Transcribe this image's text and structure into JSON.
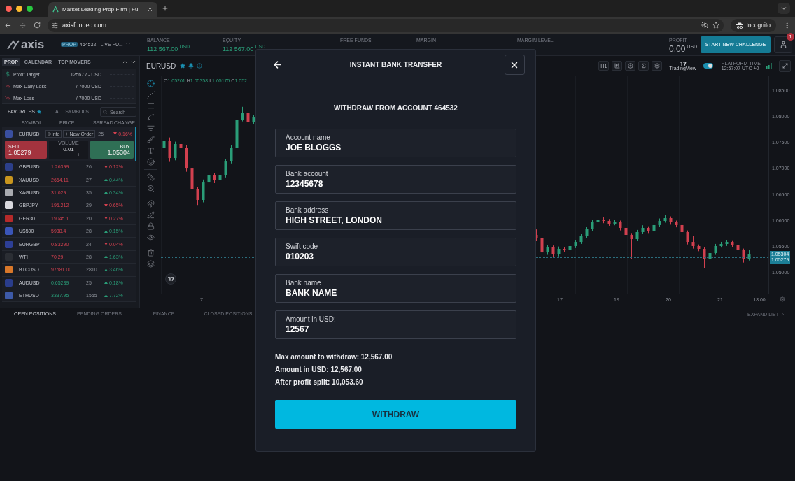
{
  "browser": {
    "tab_title": "Market Leading Prop Firm | Fu",
    "url": "axisfunded.com",
    "incognito_label": "Incognito"
  },
  "header": {
    "logo": "axis",
    "account": {
      "badge": "PROP",
      "name": "464532 - LIVE FU..."
    },
    "stats": [
      {
        "label": "BALANCE",
        "value": "112 567.00",
        "unit": "USD"
      },
      {
        "label": "EQUITY",
        "value": "112 567.00",
        "unit": "USD"
      },
      {
        "label": "FREE FUNDS"
      },
      {
        "label": "MARGIN"
      },
      {
        "label": "MARGIN LEVEL"
      }
    ],
    "profit": {
      "label": "PROFIT",
      "value": "0.00",
      "unit": "USD"
    },
    "challenge_button": "START NEW CHALLENGE",
    "notifications": "1"
  },
  "left_panel": {
    "tabs": [
      {
        "label": "PROP",
        "selected": true
      },
      {
        "label": "CALENDAR",
        "selected": false
      },
      {
        "label": "TOP MOVERS",
        "selected": false
      }
    ],
    "targets": [
      {
        "kind": "profit",
        "label": "Profit Target",
        "value": "12567 / - USD"
      },
      {
        "kind": "loss",
        "label": "Max Daily Loss",
        "value": "- / 7000 USD"
      },
      {
        "kind": "loss",
        "label": "Max Loss",
        "value": "- / 7000 USD"
      }
    ],
    "symbol_tabs": [
      {
        "label": "FAVORITES",
        "selected": true,
        "starred": true
      },
      {
        "label": "ALL SYMBOLS",
        "selected": false,
        "starred": false
      }
    ],
    "search": {
      "placeholder": "Search"
    },
    "columns": [
      "SYMBOL",
      "PRICE",
      "SPREAD",
      "CHANGE"
    ],
    "active_symbol": {
      "symbol": "EURUSD",
      "color": "#3a4fa0",
      "info_button": "Info",
      "order_button": "New Order",
      "spread": "25",
      "change": "0.16%",
      "change_up": false,
      "sell": {
        "label": "SELL",
        "price": "1.05279"
      },
      "volume": {
        "label": "VOLUME",
        "value": "0.01",
        "minus": "−",
        "plus": "+"
      },
      "buy": {
        "label": "BUY",
        "price": "1.05304"
      }
    },
    "symbols": [
      {
        "symbol": "GBPUSD",
        "color": "#2c3f8a",
        "price": "1.26399",
        "price_up": false,
        "spread": "26",
        "change": "0.12%",
        "change_up": false
      },
      {
        "symbol": "XAUUSD",
        "color": "#c9961e",
        "price": "2664.11",
        "price_up": false,
        "spread": "27",
        "change": "0.44%",
        "change_up": true
      },
      {
        "symbol": "XAGUSD",
        "color": "#a9abb0",
        "price": "31.029",
        "price_up": false,
        "spread": "35",
        "change": "0.34%",
        "change_up": true
      },
      {
        "symbol": "GBPJPY",
        "color": "#d9d9de",
        "price": "195.212",
        "price_up": false,
        "spread": "29",
        "change": "0.65%",
        "change_up": false
      },
      {
        "symbol": "GER30",
        "color": "#b52a2a",
        "price": "19045.1",
        "price_up": false,
        "spread": "20",
        "change": "0.27%",
        "change_up": false
      },
      {
        "symbol": "US500",
        "color": "#3a55b8",
        "price": "5938.4",
        "price_up": false,
        "spread": "28",
        "change": "0.15%",
        "change_up": true
      },
      {
        "symbol": "EURGBP",
        "color": "#2d3f96",
        "price": "0.83290",
        "price_up": false,
        "spread": "24",
        "change": "0.04%",
        "change_up": false
      },
      {
        "symbol": "WTI",
        "color": "#2b2e34",
        "price": "70.29",
        "price_up": false,
        "spread": "28",
        "change": "1.63%",
        "change_up": true
      },
      {
        "symbol": "BTCUSD",
        "color": "#d9782a",
        "price": "97581.00",
        "price_up": false,
        "spread": "2810",
        "change": "3.46%",
        "change_up": true
      },
      {
        "symbol": "AUDUSD",
        "color": "#2a3d8c",
        "price": "0.65239",
        "price_up": true,
        "spread": "25",
        "change": "0.18%",
        "change_up": true
      },
      {
        "symbol": "ETHUSD",
        "color": "#3d5aa8",
        "price": "3337.95",
        "price_up": true,
        "spread": "1555",
        "change": "7.72%",
        "change_up": true
      }
    ]
  },
  "chart": {
    "symbol": "EURUSD",
    "ohlc": [
      {
        "label": "O",
        "value": "1.05201"
      },
      {
        "label": "H",
        "value": "1.05358"
      },
      {
        "label": "L",
        "value": "1.05175"
      },
      {
        "label": "C",
        "value": "1.052"
      }
    ],
    "timeframe": "H1",
    "provider": "TradingView",
    "live_toggle": {
      "on": true
    },
    "platform_time": {
      "label": "PLATFORM TIME",
      "value": "12:57:07 UTC +0"
    },
    "ask": "1.05304",
    "bid": "1.05279",
    "time_labels": [
      "7",
      "17",
      "18:00"
    ],
    "chart_data": {
      "type": "candlestick",
      "xlim": [
        10.203,
        21.933
      ],
      "ylim": [
        1.0457,
        1.08783
      ],
      "xticks": [
        19,
        20,
        21
      ],
      "ref_lines": [
        {
          "value": 1.05279,
          "axis": "y"
        }
      ],
      "yticks": [
        {
          "value": 1.085,
          "label": "1.08500"
        },
        {
          "value": 1.08,
          "label": "1.08000"
        },
        {
          "value": 1.075,
          "label": "1.07500"
        },
        {
          "value": 1.07,
          "label": "1.07000"
        },
        {
          "value": 1.065,
          "label": "1.06500"
        },
        {
          "value": 1.06,
          "label": "1.06000"
        },
        {
          "value": 1.055,
          "label": "1.05500"
        },
        {
          "value": 1.05,
          "label": "1.05000"
        }
      ],
      "x": [
        10.257,
        10.365,
        10.473,
        10.581,
        10.689,
        10.798,
        10.906,
        11.014,
        11.122,
        11.23,
        11.338,
        11.446,
        11.554,
        11.662,
        11.77,
        11.878,
        11.987,
        17.446,
        17.554,
        17.662,
        17.77,
        17.878,
        17.987,
        18.095,
        18.203,
        18.311,
        18.419,
        18.527,
        18.635,
        18.743,
        18.851,
        18.959,
        19.068,
        19.176,
        19.284,
        19.392,
        19.5,
        19.608,
        19.716,
        19.824,
        19.932,
        20.041,
        20.149,
        20.257,
        20.365,
        20.473,
        20.581,
        20.689,
        20.797,
        20.905,
        21.013,
        21.121,
        21.23,
        21.338,
        21.446,
        21.554
      ],
      "ohlc": [
        [
          1.07396,
          1.0758,
          1.0734,
          1.07531
        ],
        [
          1.07531,
          1.0759,
          1.0712,
          1.07194
        ],
        [
          1.07194,
          1.0751,
          1.0715,
          1.07464
        ],
        [
          1.07464,
          1.0752,
          1.0733,
          1.07396
        ],
        [
          1.07396,
          1.0744,
          1.0693,
          1.06992
        ],
        [
          1.06992,
          1.0705,
          1.0652,
          1.06589
        ],
        [
          1.06589,
          1.0663,
          1.0629,
          1.06387
        ],
        [
          1.06387,
          1.0678,
          1.0634,
          1.06723
        ],
        [
          1.06723,
          1.0691,
          1.0668,
          1.06858
        ],
        [
          1.06858,
          1.069,
          1.0671,
          1.06764
        ],
        [
          1.06764,
          1.0692,
          1.0672,
          1.06858
        ],
        [
          1.06858,
          1.0718,
          1.0682,
          1.07127
        ],
        [
          1.07127,
          1.0745,
          1.0709,
          1.07396
        ],
        [
          1.07396,
          1.0799,
          1.0735,
          1.07935
        ],
        [
          1.07935,
          1.0818,
          1.079,
          1.08069
        ],
        [
          1.08069,
          1.0811,
          1.0783,
          1.07894
        ],
        [
          1.07894,
          1.0802,
          1.0785,
          1.07975
        ],
        [
          1.05714,
          1.0582,
          1.056,
          1.05647
        ],
        [
          1.05647,
          1.0569,
          1.0532,
          1.05377
        ],
        [
          1.05377,
          1.0552,
          1.0533,
          1.05472
        ],
        [
          1.05472,
          1.0551,
          1.0528,
          1.05337
        ],
        [
          1.05337,
          1.0549,
          1.053,
          1.05445
        ],
        [
          1.05445,
          1.0548,
          1.0538,
          1.05418
        ],
        [
          1.05418,
          1.0554,
          1.0539,
          1.05499
        ],
        [
          1.05499,
          1.0562,
          1.0546,
          1.05579
        ],
        [
          1.05579,
          1.0573,
          1.0554,
          1.05687
        ],
        [
          1.05687,
          1.0587,
          1.0565,
          1.05822
        ],
        [
          1.05822,
          1.06,
          1.0579,
          1.05957
        ],
        [
          1.05957,
          1.0609,
          1.0592,
          1.0601
        ],
        [
          1.0601,
          1.0605,
          1.0594,
          1.05983
        ],
        [
          1.05983,
          1.0602,
          1.0589,
          1.0593
        ],
        [
          1.0593,
          1.06,
          1.059,
          1.05957
        ],
        [
          1.05957,
          1.0599,
          1.058,
          1.05849
        ],
        [
          1.05849,
          1.0588,
          1.0567,
          1.05714
        ],
        [
          1.05714,
          1.0575,
          1.05243,
          1.05633
        ],
        [
          1.05633,
          1.0581,
          1.056,
          1.05768
        ],
        [
          1.05768,
          1.059,
          1.0573,
          1.05849
        ],
        [
          1.05849,
          1.0588,
          1.0575,
          1.05795
        ],
        [
          1.05795,
          1.0595,
          1.0576,
          1.05903
        ],
        [
          1.05903,
          1.0603,
          1.0587,
          1.05983
        ],
        [
          1.05983,
          1.061,
          1.0595,
          1.06037
        ],
        [
          1.06037,
          1.0607,
          1.0591,
          1.05957
        ],
        [
          1.05957,
          1.0599,
          1.0586,
          1.05903
        ],
        [
          1.05903,
          1.0594,
          1.0572,
          1.05768
        ],
        [
          1.05768,
          1.058,
          1.0553,
          1.05579
        ],
        [
          1.05579,
          1.057,
          1.0545,
          1.05499
        ],
        [
          1.05499,
          1.0553,
          1.054,
          1.05445
        ],
        [
          1.05445,
          1.0548,
          1.0508,
          1.05256
        ],
        [
          1.05256,
          1.0541,
          1.0522,
          1.05364
        ],
        [
          1.05364,
          1.0554,
          1.0533,
          1.05499
        ],
        [
          1.05499,
          1.0558,
          1.0547,
          1.05539
        ],
        [
          1.05539,
          1.0562,
          1.055,
          1.05579
        ],
        [
          1.05579,
          1.0561,
          1.0548,
          1.05525
        ],
        [
          1.05525,
          1.0556,
          1.0537,
          1.05418
        ],
        [
          1.05418,
          1.0545,
          1.0518,
          1.05256
        ],
        [
          1.05256,
          1.0542,
          1.0522,
          1.05337
        ]
      ]
    }
  },
  "bottom_tabs": [
    {
      "label": "OPEN POSITIONS",
      "selected": true
    },
    {
      "label": "PENDING ORDERS",
      "selected": false
    },
    {
      "label": "FINANCE",
      "selected": false
    },
    {
      "label": "CLOSED POSITIONS",
      "selected": false
    }
  ],
  "expand_label": "EXPAND LIST",
  "modal": {
    "title": "INSTANT BANK TRANSFER",
    "subtitle": "WITHDRAW FROM ACCOUNT 464532",
    "fields": [
      {
        "label": "Account name",
        "value": "JOE BLOGGS"
      },
      {
        "label": "Bank account",
        "value": "12345678"
      },
      {
        "label": "Bank address",
        "value": "HIGH STREET, LONDON"
      },
      {
        "label": "Swift code",
        "value": "010203"
      },
      {
        "label": "Bank name",
        "value": "BANK NAME"
      },
      {
        "label": "Amount in USD:",
        "value": "12567"
      }
    ],
    "summary": [
      {
        "label": "Max amount to withdraw:",
        "value": "12,567.00"
      },
      {
        "label": "Amount in USD:",
        "value": "12,567.00"
      },
      {
        "label": "After profit split:",
        "value": "10,053.60"
      }
    ],
    "submit": "WITHDRAW"
  }
}
